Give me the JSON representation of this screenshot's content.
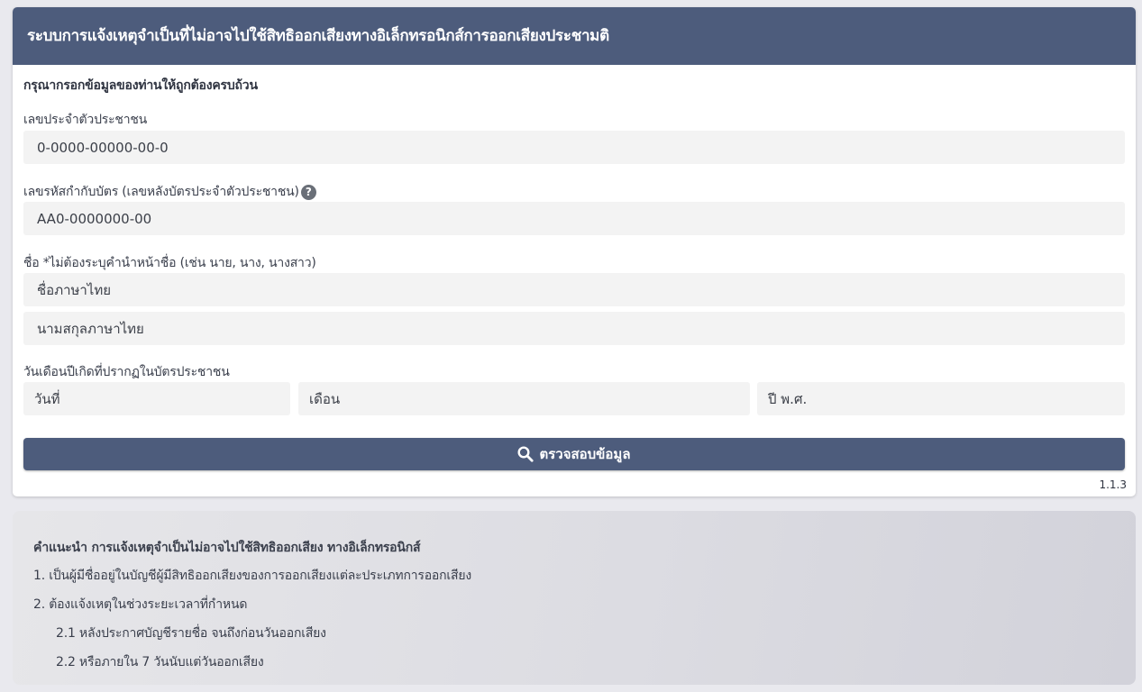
{
  "header": {
    "title": "ระบบการแจ้งเหตุจำเป็นที่ไม่อาจไปใช้สิทธิออกเสียงทางอิเล็กทรอนิกส์การออกเสียงประชามติ"
  },
  "form": {
    "intro": "กรุณากรอกข้อมูลของท่านให้ถูกต้องครบถ้วน",
    "id_label": "เลขประจำตัวประชาชน",
    "id_placeholder": "0-0000-00000-00-0",
    "laser_label": "เลขรหัสกำกับบัตร (เลขหลังบัตรประจำตัวประชาชน)",
    "laser_placeholder": "AA0-0000000-00",
    "name_label": "ชื่อ *ไม่ต้องระบุคำนำหน้าชื่อ (เช่น นาย, นาง, นางสาว)",
    "firstname_placeholder": "ชื่อภาษาไทย",
    "lastname_placeholder": "นามสกุลภาษาไทย",
    "dob_label": "วันเดือนปีเกิดที่ปรากฏในบัตรประชาชน",
    "day_placeholder": "วันที่",
    "month_placeholder": "เดือน",
    "year_placeholder": "ปี พ.ศ.",
    "submit_label": "ตรวจสอบข้อมูล",
    "help_icon": "question-circle-icon",
    "submit_icon": "search-icon"
  },
  "version": "1.1.3",
  "advice": {
    "title": "คำแนะนำ การแจ้งเหตุจำเป็นไม่อาจไปใช้สิทธิออกเสียง ทางอิเล็กทรอนิกส์",
    "items": [
      "1. เป็นผู้มีชื่ออยู่ในบัญชีผู้มีสิทธิออกเสียงของการออกเสียงแต่ละประเภทการออกเสียง",
      "2. ต้องแจ้งเหตุในช่วงระยะเวลาที่กำหนด",
      "2.1 หลังประกาศบัญชีรายชื่อ จนถึงก่อนวันออกเสียง",
      "2.2 หรือภายใน 7 วันนับแต่วันออกเสียง"
    ]
  },
  "colors": {
    "header_bg": "#4d5c7c",
    "button_bg": "#4d5c7c",
    "input_bg": "#f3f3f3",
    "page_bg": "#e9e9ee"
  }
}
